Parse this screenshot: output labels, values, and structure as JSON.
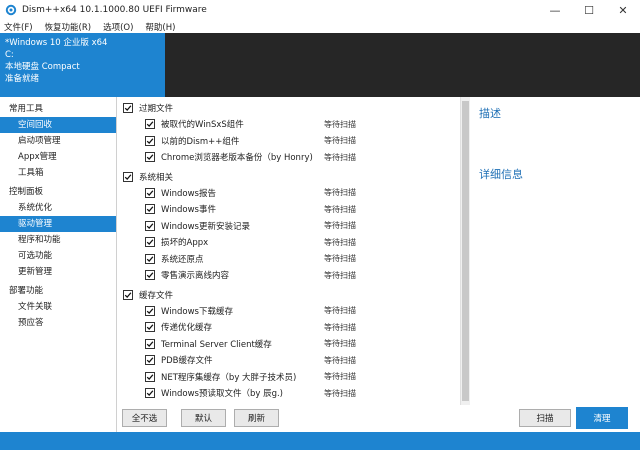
{
  "window": {
    "title": "Dism++x64 10.1.1000.80 UEFI Firmware",
    "minimize": "—",
    "maximize": "☐",
    "close": "✕"
  },
  "menu": [
    "文件(F)",
    "恢复功能(R)",
    "选项(O)",
    "帮助(H)"
  ],
  "sysinfo": {
    "os": "*Windows 10 企业版 x64",
    "drive": "C:",
    "disk": "本地硬盘 Compact",
    "status": "准备就绪"
  },
  "sidebar": [
    {
      "type": "group",
      "label": "常用工具"
    },
    {
      "type": "item",
      "label": "空间回收",
      "active": true
    },
    {
      "type": "item",
      "label": "启动项管理"
    },
    {
      "type": "item",
      "label": "Appx管理"
    },
    {
      "type": "item",
      "label": "工具箱"
    },
    {
      "type": "group",
      "label": "控制面板"
    },
    {
      "type": "item",
      "label": "系统优化"
    },
    {
      "type": "item",
      "label": "驱动管理",
      "active": true
    },
    {
      "type": "item",
      "label": "程序和功能"
    },
    {
      "type": "item",
      "label": "可选功能"
    },
    {
      "type": "item",
      "label": "更新管理"
    },
    {
      "type": "group",
      "label": "部署功能"
    },
    {
      "type": "item",
      "label": "文件关联"
    },
    {
      "type": "item",
      "label": "预应答"
    }
  ],
  "categories": [
    {
      "label": "过期文件",
      "items": [
        {
          "label": "被取代的WinSxS组件",
          "status": "等待扫描"
        },
        {
          "label": "以前的Dism++组件",
          "status": "等待扫描"
        },
        {
          "label": "Chrome浏览器老版本备份（by Honry)",
          "status": "等待扫描"
        }
      ]
    },
    {
      "label": "系统相关",
      "items": [
        {
          "label": "Windows报告",
          "status": "等待扫描"
        },
        {
          "label": "Windows事件",
          "status": "等待扫描"
        },
        {
          "label": "Windows更新安装记录",
          "status": "等待扫描"
        },
        {
          "label": "损坏的Appx",
          "status": "等待扫描"
        },
        {
          "label": "系统还原点",
          "status": "等待扫描"
        },
        {
          "label": "零售演示离线内容",
          "status": "等待扫描"
        }
      ]
    },
    {
      "label": "缓存文件",
      "items": [
        {
          "label": "Windows下载缓存",
          "status": "等待扫描"
        },
        {
          "label": "传递优化缓存",
          "status": "等待扫描"
        },
        {
          "label": "Terminal Server Client缓存",
          "status": "等待扫描"
        },
        {
          "label": "PDB缓存文件",
          "status": "等待扫描"
        },
        {
          "label": "NET程序集缓存（by 大胖子技术员)",
          "status": "等待扫描"
        },
        {
          "label": "Windows预读取文件（by 辰g.)",
          "status": "等待扫描"
        }
      ]
    }
  ],
  "right": {
    "description": "描述",
    "details": "详细信息"
  },
  "buttons": {
    "select_none": "全不选",
    "default": "默认",
    "refresh": "刷新",
    "scan": "扫描",
    "clean": "清理"
  }
}
